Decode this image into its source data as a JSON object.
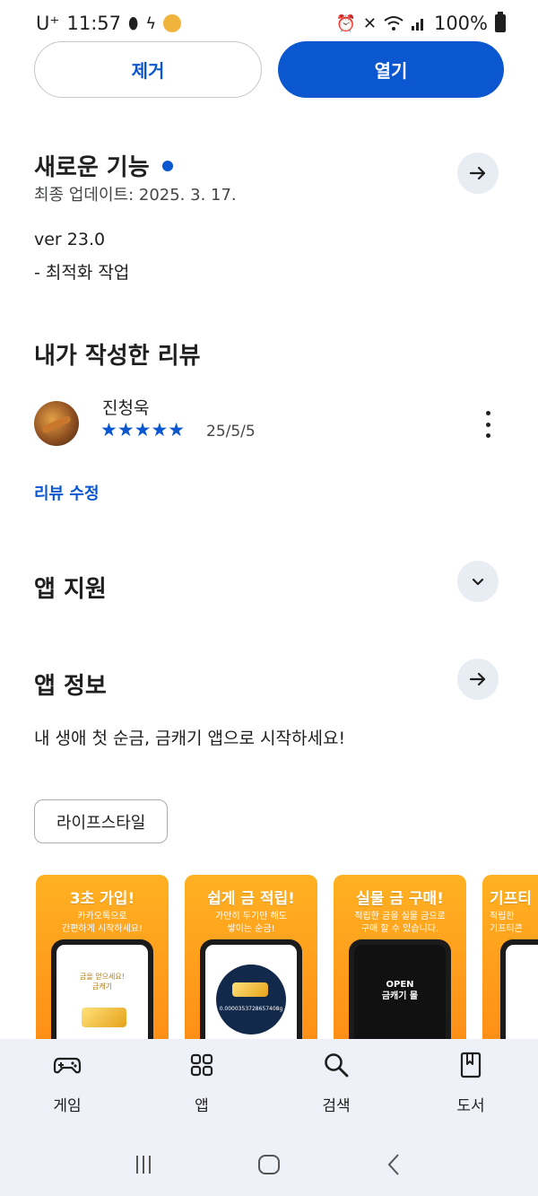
{
  "status_bar": {
    "carrier": "U⁺",
    "time": "11:57",
    "battery_text": "100%"
  },
  "actions": {
    "remove_label": "제거",
    "open_label": "열기"
  },
  "whats_new": {
    "title": "새로운 기능",
    "last_updated": "최종 업데이트: 2025. 3. 17.",
    "version": "ver 23.0",
    "notes": "- 최적화 작업"
  },
  "my_review": {
    "title": "내가 작성한 리뷰",
    "reviewer_name": "진청욱",
    "rating": 5,
    "stars": "★★★★★",
    "date": "25/5/5",
    "edit_label": "리뷰 수정"
  },
  "app_support": {
    "title": "앱 지원"
  },
  "app_info": {
    "title": "앱 정보",
    "description": "내 생애 첫 순금, 금캐기 앱으로 시작하세요!",
    "category_chip": "라이프스타일"
  },
  "screenshots": [
    {
      "title": "3초 가입!",
      "subtitle": "카카오톡으로\n간편하게 시작하세요!",
      "screen_text": "금을 얻으세요!\n금캐기"
    },
    {
      "title": "쉽게 금 적립!",
      "subtitle": "가만히 두기만 해도\n쌓이는 순금!",
      "screen_text": "0.0000353728657408g"
    },
    {
      "title": "실물 금 구매!",
      "subtitle": "적립한 금을 실물 금으로\n구매 할 수 있습니다.",
      "screen_text": "OPEN\n금캐기 몰"
    },
    {
      "title": "기프티",
      "subtitle": "적립한\n기프티콘",
      "screen_text": ""
    }
  ],
  "bottom_nav": [
    {
      "label": "게임",
      "icon": "gamepad-icon"
    },
    {
      "label": "앱",
      "icon": "apps-grid-icon"
    },
    {
      "label": "검색",
      "icon": "search-icon"
    },
    {
      "label": "도서",
      "icon": "book-icon"
    }
  ],
  "colors": {
    "accent": "#0b57d0",
    "nav_bg": "#eef1f7",
    "circle_btn_bg": "#e8ecf3",
    "shot_orange": "#ff9a1a"
  }
}
